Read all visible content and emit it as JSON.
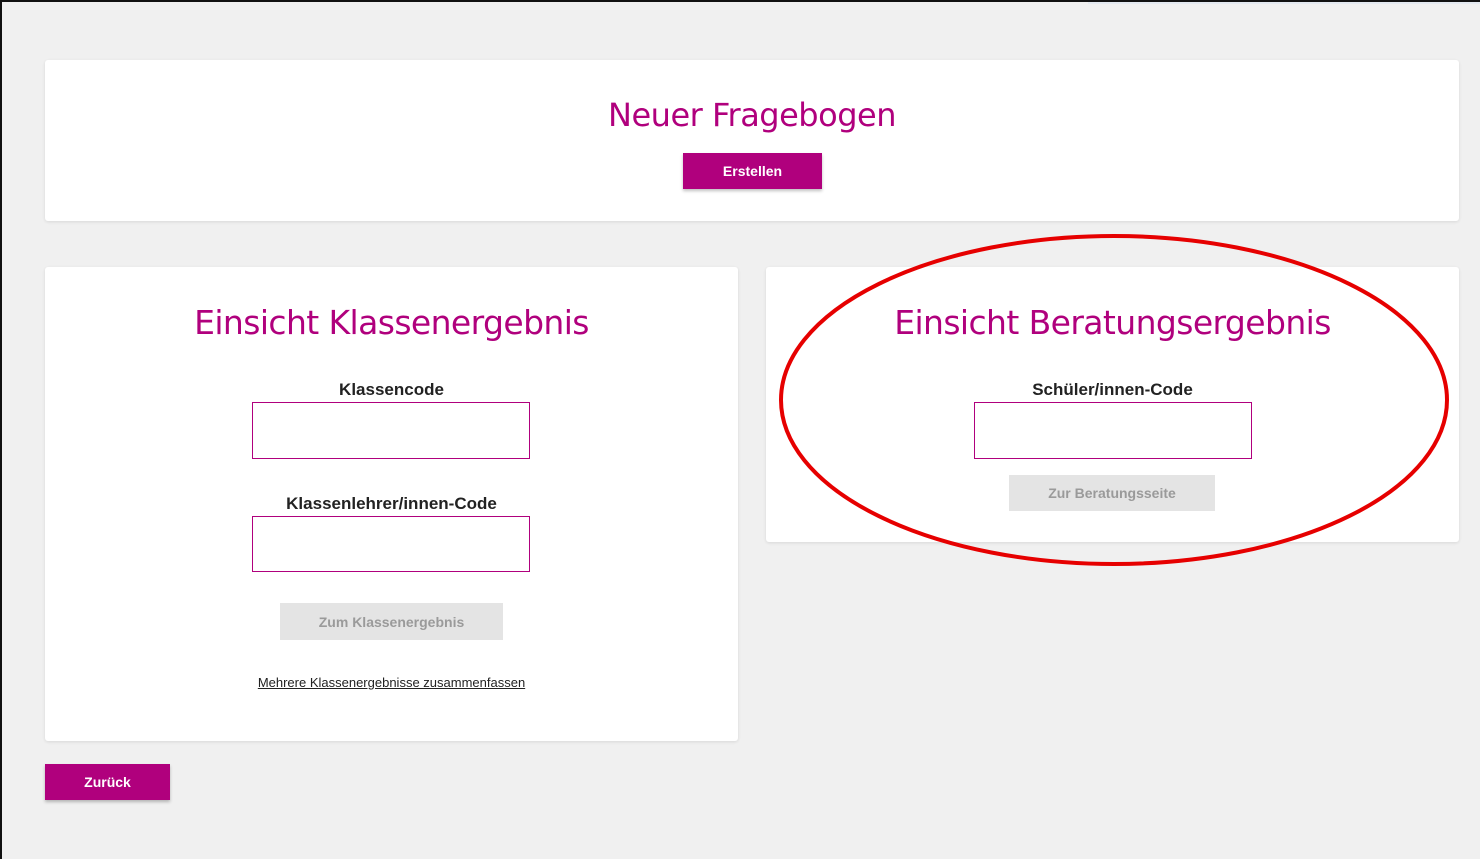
{
  "new_questionnaire": {
    "title": "Neuer Fragebogen",
    "create_button": "Erstellen"
  },
  "class_result": {
    "title": "Einsicht Klassenergebnis",
    "class_code_label": "Klassencode",
    "class_code_value": "",
    "teacher_code_label": "Klassenlehrer/innen-Code",
    "teacher_code_value": "",
    "submit_button": "Zum Klassenergebnis",
    "merge_link": "Mehrere Klassenergebnisse zusammenfassen"
  },
  "counseling_result": {
    "title": "Einsicht Beratungsergebnis",
    "student_code_label": "Schüler/innen-Code",
    "student_code_value": "",
    "submit_button": "Zur Beratungsseite"
  },
  "navigation": {
    "back_button": "Zurück"
  },
  "colors": {
    "accent": "#b0007d",
    "background": "#f0f0f0",
    "disabled_button": "#e4e4e4",
    "annotation": "#e60000"
  }
}
